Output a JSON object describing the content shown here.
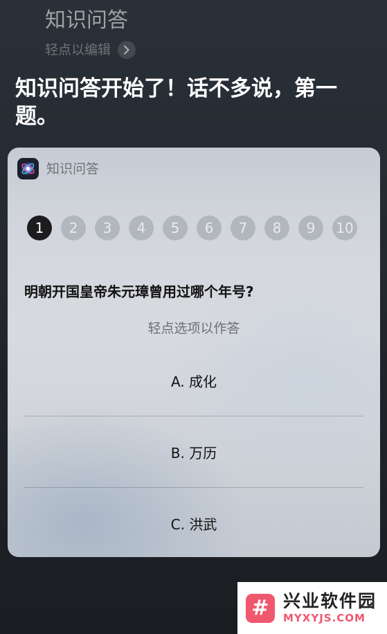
{
  "query": {
    "title": "知识问答",
    "edit_hint": "轻点以编辑",
    "edit_icon": "chevron-right-icon"
  },
  "siri": {
    "response": "知识问答开始了！话不多说，第一题。"
  },
  "card": {
    "app_icon": "siri-orb-icon",
    "app_name": "知识问答",
    "steps": [
      "1",
      "2",
      "3",
      "4",
      "5",
      "6",
      "7",
      "8",
      "9",
      "10"
    ],
    "current_step": 1,
    "question": "明朝开国皇帝朱元璋曾用过哪个年号?",
    "answer_hint": "轻点选项以作答",
    "options": [
      "A. 成化",
      "B. 万历",
      "C. 洪武"
    ]
  },
  "watermark": {
    "logo_icon": "hash-logo-icon",
    "name": "兴业软件园",
    "domain": "MYXYJS.COM"
  },
  "colors": {
    "watermark_accent": "#f0586e",
    "active_step": "#1c1c1e"
  }
}
